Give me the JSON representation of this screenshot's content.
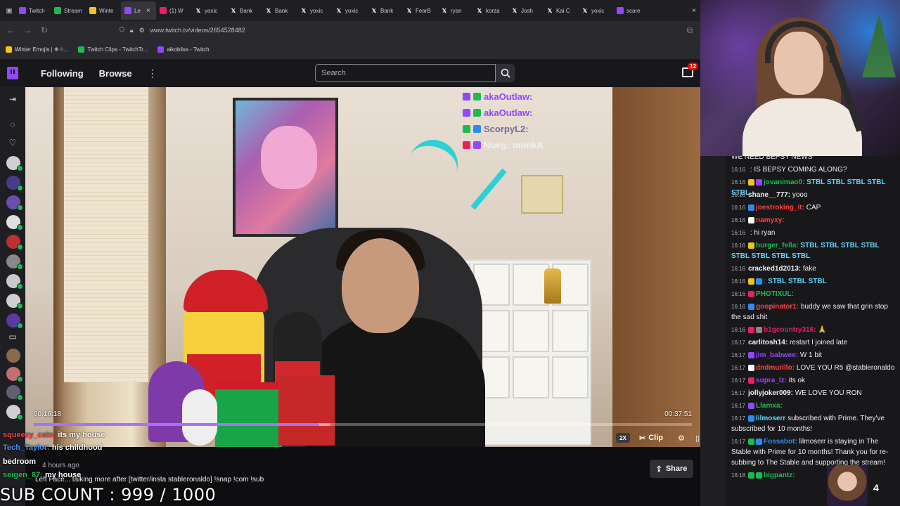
{
  "browser": {
    "tabs": [
      {
        "label": "Twitch",
        "icon": "twitch-icon",
        "color": "#9147ff",
        "active": false
      },
      {
        "label": "Stream",
        "icon": "speaker-icon",
        "color": "#1db954",
        "active": false
      },
      {
        "label": "Winte",
        "icon": "folder-icon",
        "color": "#f0c419",
        "active": false
      },
      {
        "label": "Le",
        "icon": "twitch-icon",
        "color": "#9147ff",
        "active": true
      },
      {
        "label": "(1) W",
        "icon": "heart-icon",
        "color": "#e91e63",
        "active": false
      },
      {
        "label": "yoxic",
        "icon": "x-icon",
        "color": "#ffffff",
        "active": false
      },
      {
        "label": "Bank",
        "icon": "x-icon",
        "color": "#ffffff",
        "active": false
      },
      {
        "label": "Bank",
        "icon": "x-icon",
        "color": "#ffffff",
        "active": false
      },
      {
        "label": "yoxic",
        "icon": "x-icon",
        "color": "#ffffff",
        "active": false
      },
      {
        "label": "yoxic",
        "icon": "x-icon",
        "color": "#ffffff",
        "active": false
      },
      {
        "label": "Bank",
        "icon": "x-icon",
        "color": "#ffffff",
        "active": false
      },
      {
        "label": "FearB",
        "icon": "x-icon",
        "color": "#ffffff",
        "active": false
      },
      {
        "label": "ryan",
        "icon": "x-icon",
        "color": "#ffffff",
        "active": false
      },
      {
        "label": "korza",
        "icon": "x-icon",
        "color": "#ffffff",
        "active": false
      },
      {
        "label": "Josh",
        "icon": "x-icon",
        "color": "#ffffff",
        "active": false
      },
      {
        "label": "Kai C",
        "icon": "x-icon",
        "color": "#ffffff",
        "active": false
      },
      {
        "label": "yoxic",
        "icon": "x-icon",
        "color": "#ffffff",
        "active": false
      },
      {
        "label": "scare",
        "icon": "twitch-icon",
        "color": "#9147ff",
        "active": false
      }
    ],
    "url": "www.twitch.tv/videos/2654528482",
    "bookmarks": [
      {
        "label": "Winter Emojis | ❄☃...",
        "color": "#f0c419"
      },
      {
        "label": "Twitch Clips - TwitchTr...",
        "color": "#1db954"
      },
      {
        "label": "aikobliss - Twitch",
        "color": "#9147ff"
      }
    ]
  },
  "twitch": {
    "nav": {
      "following": "Following",
      "browse": "Browse",
      "more": "⋮"
    },
    "search": {
      "placeholder": "Search"
    },
    "notifications": {
      "count": "12"
    },
    "colors": {
      "brand": "#9147ff",
      "progress": "#a970ff"
    }
  },
  "video": {
    "overlay_chat": [
      {
        "name": "akaOutlaw:",
        "message": "",
        "color": "#9147ff"
      },
      {
        "name": "akaOutlaw:",
        "message": "",
        "color": "#9147ff"
      },
      {
        "name": "ScorpyL2:",
        "message": "",
        "color": "#6f6f9a"
      },
      {
        "name": "Nueg:",
        "message": "monkA",
        "color": "#f0f0f0"
      }
    ],
    "time_current": "00:16:18",
    "time_total": "00:37:51",
    "progress_fraction": 0.434,
    "buffered_fraction": 0.45,
    "controls": {
      "speed": "2X",
      "clip": "Clip"
    },
    "bottom_overlay": [
      {
        "name": "squeezy_cats:",
        "message": "its my house",
        "color": "#ff4040"
      },
      {
        "name": "Tech_Taylor:",
        "message": "his childhood",
        "color": "#4a90e2"
      },
      {
        "name": "",
        "message": "bedroom",
        "color": "#ffffff"
      },
      {
        "name": "seigen_87:",
        "message": "my house",
        "color": "#1db954"
      }
    ]
  },
  "info": {
    "age": "4 hours ago",
    "title": "Left Face... talking more after [twitter/insta stableronaldo] !snap !com !sub",
    "share": "Share"
  },
  "overlay": {
    "sub_count": "SUB COUNT : 999 / 1000"
  },
  "chat": {
    "messages": [
      {
        "time": "",
        "user": "",
        "text": "WE NEED BEPSY NEWS",
        "userColor": "#1db954",
        "badges": []
      },
      {
        "time": "16:16",
        "user": "",
        "text": ": IS BEPSY COMING ALONG?",
        "userColor": "#2b5ef0",
        "badges": []
      },
      {
        "time": "16:16",
        "user": "jovanimao0:",
        "text": "STBL STBL STBL STBL STBL",
        "userColor": "#1db954",
        "badges": [
          "#f0c419",
          "#9147ff"
        ],
        "cyan": true
      },
      {
        "time": "16:16",
        "user": "shane__777:",
        "text": "yooo",
        "userColor": "#efeff1",
        "badges": []
      },
      {
        "time": "16:16",
        "user": "joestroking_it:",
        "text": "CAP",
        "userColor": "#ff4040",
        "badges": [
          "#2b8cf0"
        ]
      },
      {
        "time": "16:16",
        "user": "namyxy:",
        "text": "",
        "userColor": "#ff4040",
        "badges": [
          "#ffffff"
        ]
      },
      {
        "time": "16:16",
        "user": "",
        "text": ": hi ryan",
        "userColor": "#2b5ef0",
        "badges": []
      },
      {
        "time": "16:16",
        "user": "burger_fella:",
        "text": "STBL STBL STBL STBL STBL STBL STBL STBL",
        "userColor": "#1db954",
        "badges": [
          "#f0c419"
        ],
        "cyan": true
      },
      {
        "time": "16:16",
        "user": "cracked1d2013:",
        "text": "fake",
        "userColor": "#efeff1",
        "badges": []
      },
      {
        "time": "16:16",
        "user": ":",
        "text": "STBL STBL STBL",
        "userColor": "#2b5ef0",
        "badges": [
          "#f0c419",
          "#2b8cf0"
        ],
        "cyan": true
      },
      {
        "time": "16:16",
        "user": "PHOTIXUL:",
        "text": "",
        "userColor": "#1db954",
        "badges": [
          "#e91e63"
        ]
      },
      {
        "time": "16:16",
        "user": "goopinator1:",
        "text": "buddy we saw that grin stop the sad shit",
        "userColor": "#ff4040",
        "badges": [
          "#2b8cf0"
        ]
      },
      {
        "time": "16:16",
        "user": "b1gcountry316:",
        "text": "🙏",
        "userColor": "#e91e63",
        "badges": [
          "#e91e63",
          "#888888"
        ]
      },
      {
        "time": "16:17",
        "user": "carlitosh14:",
        "text": "restart I joined late",
        "userColor": "#efeff1",
        "badges": []
      },
      {
        "time": "16:17",
        "user": "jim_babwee:",
        "text": "W 1 bit",
        "userColor": "#9147ff",
        "badges": [
          "#9147ff"
        ]
      },
      {
        "time": "16:17",
        "user": "dndmurillo:",
        "text": "LOVE YOU R5 @stableronaldo",
        "userColor": "#ff4040",
        "badges": [
          "#ffffff"
        ]
      },
      {
        "time": "16:17",
        "user": "supra_lz:",
        "text": "its ok",
        "userColor": "#9147ff",
        "badges": [
          "#e91e63"
        ]
      },
      {
        "time": "16:17",
        "user": "jollyjoker009:",
        "text": "WE LOVE YOU RON",
        "userColor": "#efeff1",
        "badges": []
      },
      {
        "time": "16:17",
        "user": "Llamxa:",
        "text": "",
        "userColor": "#1db954",
        "badges": [
          "#9147ff"
        ]
      },
      {
        "time": "16:17",
        "user": "lilmoserr",
        "text": "subscribed with Prime. They've subscribed for 10 months!",
        "userColor": "#5fd7ff",
        "badges": [
          "#2b8cf0"
        ]
      },
      {
        "time": "16:17",
        "user": "Fossabot:",
        "text": "lilmoserr is staying in The Stable with Prime for 10 months! Thank you for re-subbing to The Stable and supporting the stream!",
        "userColor": "#2b8cf0",
        "badges": [
          "#1db954",
          "#2b8cf0"
        ]
      },
      {
        "time": "16:18",
        "user": "bigpantz:",
        "text": "",
        "userColor": "#1db954",
        "badges": [
          "#1db954",
          "#1db954"
        ]
      }
    ],
    "mini_cam_number": "4"
  }
}
